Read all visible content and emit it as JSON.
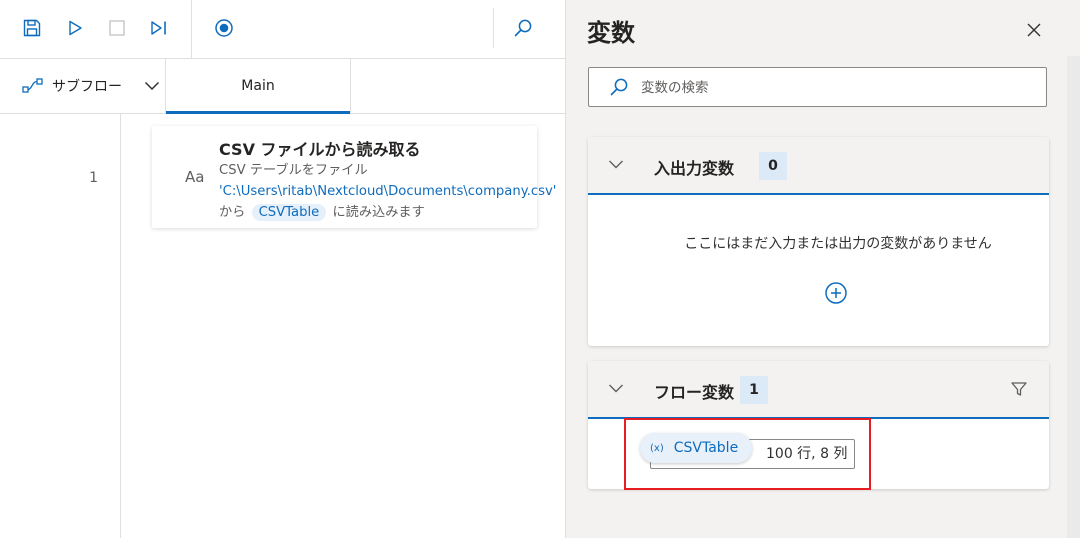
{
  "toolbar": {
    "buttons": [
      {
        "name": "save",
        "icon": "save-icon"
      },
      {
        "name": "run",
        "icon": "play-icon"
      },
      {
        "name": "stop",
        "icon": "stop-icon"
      },
      {
        "name": "run-next",
        "icon": "step-icon"
      },
      {
        "name": "record",
        "icon": "record-icon"
      },
      {
        "name": "search",
        "icon": "search-icon"
      }
    ]
  },
  "tabs": {
    "subflow_label": "サブフロー",
    "main_label": "Main"
  },
  "editor": {
    "line_number": "1",
    "action": {
      "icon_text": "Aa",
      "title": "CSV ファイルから読み取る",
      "desc_prefix": "CSV テーブルをファイル ",
      "desc_path": "'C:\\Users\\ritab\\Nextcloud\\Documents\\company.csv'",
      "desc_from": "から",
      "desc_var": "CSVTable",
      "desc_suffix": "に読み込みます"
    }
  },
  "variables_pane": {
    "title": "変数",
    "search_placeholder": "変数の検索",
    "io_section": {
      "title": "入出力変数",
      "count": "0",
      "empty_text": "ここにはまだ入力または出力の変数がありません"
    },
    "flow_section": {
      "title": "フロー変数",
      "count": "1",
      "variable": {
        "prefix": "(x)",
        "name": "CSVTable",
        "info": "100 行, 8 列"
      }
    }
  },
  "colors": {
    "accent": "#0f6cbd",
    "highlight_border": "#e81c23",
    "pane_bg": "#f3f2f1",
    "count_bg": "#dce9f6"
  }
}
